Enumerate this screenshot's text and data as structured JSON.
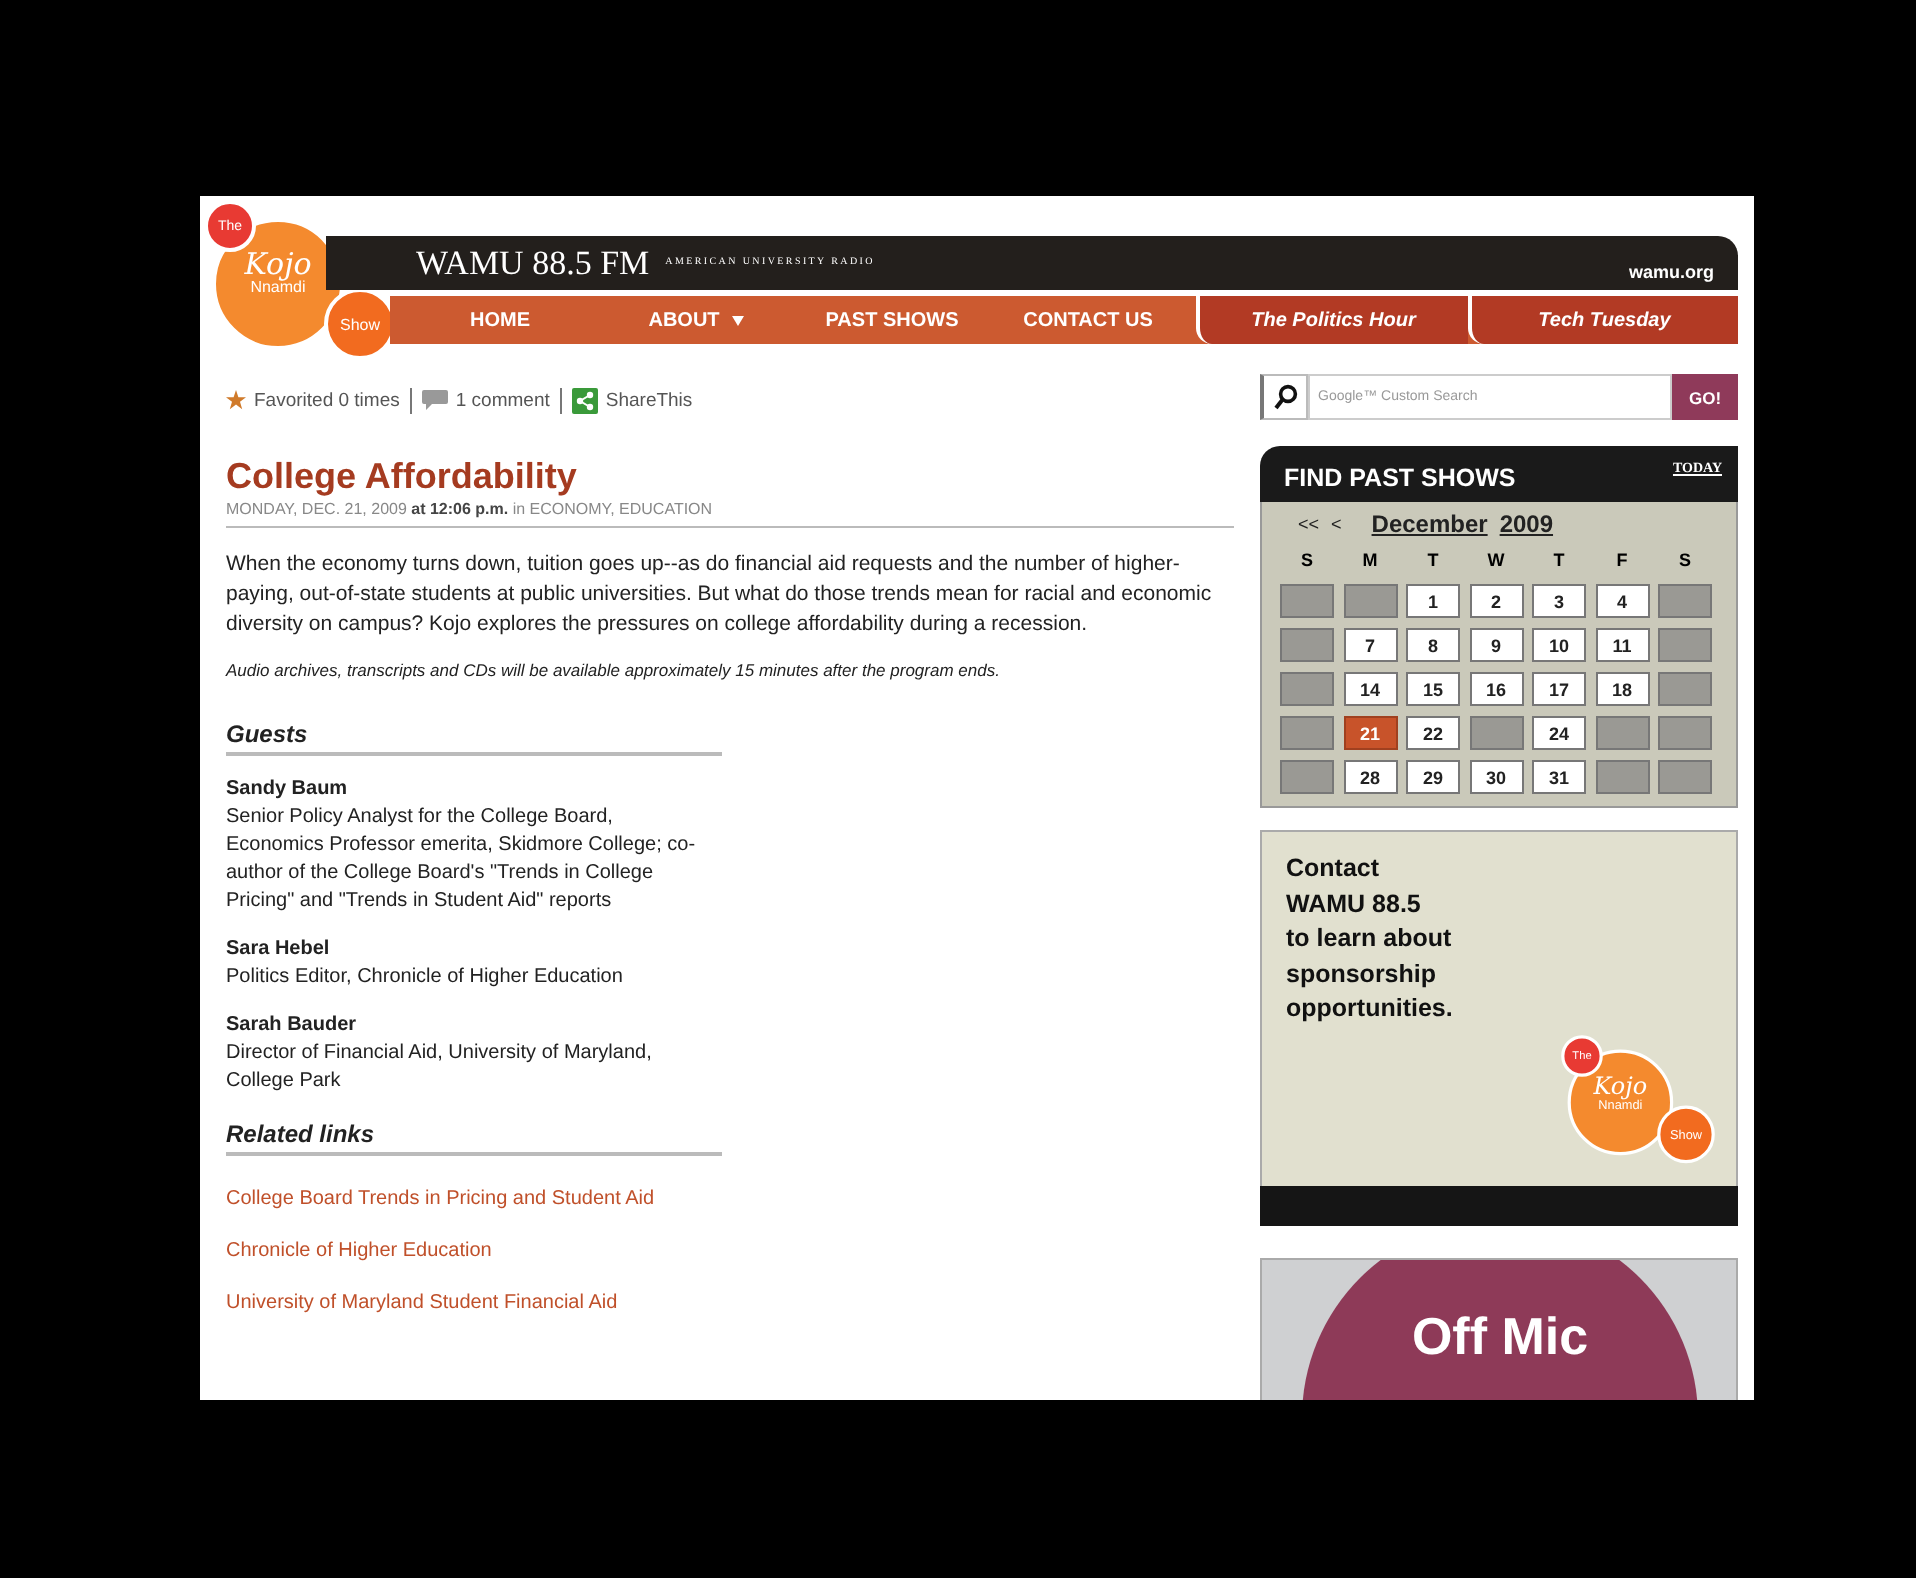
{
  "logo": {
    "the": "The",
    "name": "Kojo",
    "surname": "Nnamdi",
    "show": "Show"
  },
  "header": {
    "station": "WAMU 88.5 FM",
    "tagline": "AMERICAN UNIVERSITY RADIO",
    "site": "wamu.org"
  },
  "nav": [
    {
      "label": "HOME",
      "kind": "main",
      "has_menu": false
    },
    {
      "label": "ABOUT",
      "kind": "main",
      "has_menu": true
    },
    {
      "label": "PAST SHOWS",
      "kind": "main",
      "has_menu": false
    },
    {
      "label": "CONTACT US",
      "kind": "main",
      "has_menu": false
    },
    {
      "label": "The Politics Hour",
      "kind": "show",
      "has_menu": false
    },
    {
      "label": "Tech Tuesday",
      "kind": "show",
      "has_menu": false
    }
  ],
  "toolbar": {
    "favorited": "Favorited 0 times",
    "comments": "1 comment",
    "share": "ShareThis"
  },
  "article": {
    "title": "College Affordability",
    "meta": "MONDAY, DEC. 21, 2009 **at 12:06 p.m.** in",
    "categories": "ECONOMY, EDUCATION",
    "body": "When the economy turns down, tuition goes up--as do financial aid requests and the number of higher-paying, out-of-state students at public universities. But what do those trends mean for racial and economic diversity on campus? Kojo explores the pressures on college affordability during a recession.",
    "note": "Audio archives, transcripts and CDs will be available approximately 15 minutes after the program ends.",
    "guests_heading": "Guests",
    "guests": [
      {
        "name": "Sandy Baum",
        "bio": "Senior Policy Analyst for the College Board, Economics Professor emerita, Skidmore College; co-author of the College Board's \"Trends in College Pricing\" and \"Trends in Student Aid\" reports"
      },
      {
        "name": "Sara Hebel",
        "bio": "Politics Editor, Chronicle of Higher Education"
      },
      {
        "name": "Sarah Bauder",
        "bio": "Director of Financial Aid, University of Maryland, College Park"
      }
    ],
    "links_heading": "Related links",
    "links": [
      "College Board Trends in Pricing and Student Aid",
      "Chronicle of Higher Education",
      "University of Maryland Student Financial Aid"
    ]
  },
  "search": {
    "placeholder": "Google™ Custom Search",
    "button": "GO!"
  },
  "calendar": {
    "title": "FIND PAST SHOWS",
    "today": "TODAY",
    "first": "<<",
    "prev": "<",
    "month": "December",
    "year": "2009",
    "weekdays": [
      "S",
      "M",
      "T",
      "W",
      "T",
      "F",
      "S"
    ],
    "weeks": [
      {
        "days": [
          {
            "kind": "empty"
          },
          {
            "kind": "empty"
          },
          {
            "kind": "link",
            "day": "1",
            "selected": false
          },
          {
            "kind": "link",
            "day": "2",
            "selected": false
          },
          {
            "kind": "link",
            "day": "3",
            "selected": false
          },
          {
            "kind": "link",
            "day": "4",
            "selected": false
          },
          {
            "kind": "empty"
          }
        ]
      },
      {
        "days": [
          {
            "kind": "empty"
          },
          {
            "kind": "link",
            "day": "7",
            "selected": false
          },
          {
            "kind": "link",
            "day": "8",
            "selected": false
          },
          {
            "kind": "link",
            "day": "9",
            "selected": false
          },
          {
            "kind": "link",
            "day": "10",
            "selected": false
          },
          {
            "kind": "link",
            "day": "11",
            "selected": false
          },
          {
            "kind": "empty"
          }
        ]
      },
      {
        "days": [
          {
            "kind": "empty"
          },
          {
            "kind": "link",
            "day": "14",
            "selected": false
          },
          {
            "kind": "link",
            "day": "15",
            "selected": false
          },
          {
            "kind": "link",
            "day": "16",
            "selected": false
          },
          {
            "kind": "link",
            "day": "17",
            "selected": false
          },
          {
            "kind": "link",
            "day": "18",
            "selected": false
          },
          {
            "kind": "empty"
          }
        ]
      },
      {
        "days": [
          {
            "kind": "empty"
          },
          {
            "kind": "link",
            "day": "21",
            "selected": true
          },
          {
            "kind": "link",
            "day": "22",
            "selected": false
          },
          {
            "kind": "empty"
          },
          {
            "kind": "link",
            "day": "24",
            "selected": false
          },
          {
            "kind": "empty"
          },
          {
            "kind": "empty"
          }
        ]
      },
      {
        "days": [
          {
            "kind": "empty"
          },
          {
            "kind": "link",
            "day": "28",
            "selected": false
          },
          {
            "kind": "link",
            "day": "29",
            "selected": false
          },
          {
            "kind": "link",
            "day": "30",
            "selected": false
          },
          {
            "kind": "link",
            "day": "31",
            "selected": false
          },
          {
            "kind": "empty"
          },
          {
            "kind": "empty"
          }
        ]
      }
    ]
  },
  "ad": {
    "lines": [
      "Contact",
      "WAMU 88.5",
      "to learn about",
      "sponsorship",
      "opportunities."
    ],
    "logo": {
      "the": "The",
      "name": "Kojo",
      "surname": "Nnamdi",
      "show": "Show"
    }
  },
  "promo": {
    "title": "Off Mic"
  }
}
